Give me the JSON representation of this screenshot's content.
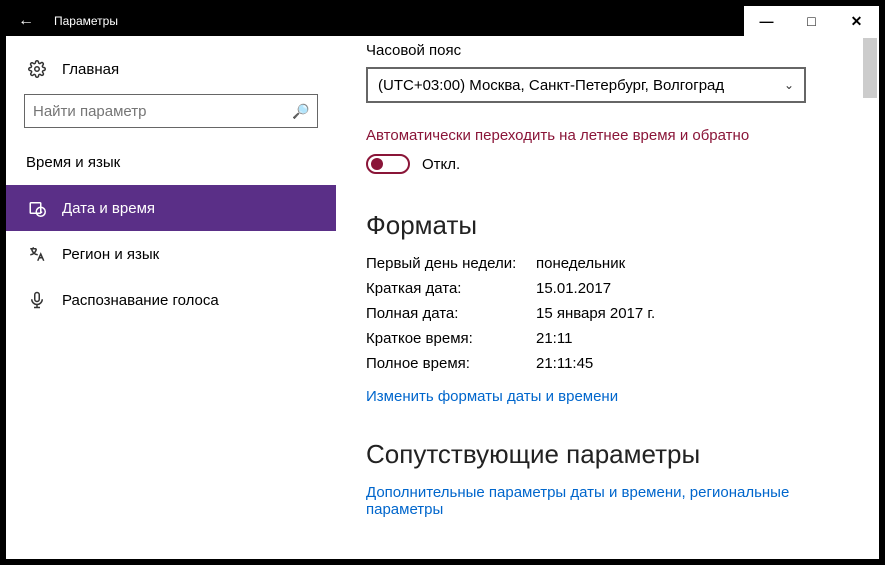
{
  "titlebar": {
    "title": "Параметры"
  },
  "sidebar": {
    "home": "Главная",
    "search_placeholder": "Найти параметр",
    "category": "Время и язык",
    "items": [
      {
        "label": "Дата и время",
        "icon": "clock-calendar-icon",
        "active": true
      },
      {
        "label": "Регион и язык",
        "icon": "language-icon",
        "active": false
      },
      {
        "label": "Распознавание голоса",
        "icon": "microphone-icon",
        "active": false
      }
    ]
  },
  "content": {
    "timezone": {
      "label": "Часовой пояс",
      "value": "(UTC+03:00) Москва, Санкт-Петербург, Волгоград"
    },
    "dst": {
      "label": "Автоматически переходить на летнее время и обратно",
      "state": "Откл."
    },
    "formats": {
      "heading": "Форматы",
      "rows": [
        {
          "k": "Первый день недели:",
          "v": "понедельник"
        },
        {
          "k": "Краткая дата:",
          "v": "15.01.2017"
        },
        {
          "k": "Полная дата:",
          "v": "15 января 2017 г."
        },
        {
          "k": "Краткое время:",
          "v": "21:11"
        },
        {
          "k": "Полное время:",
          "v": "21:11:45"
        }
      ],
      "link": "Изменить форматы даты и времени"
    },
    "related": {
      "heading": "Сопутствующие параметры",
      "link": "Дополнительные параметры даты и времени, региональные параметры"
    }
  }
}
